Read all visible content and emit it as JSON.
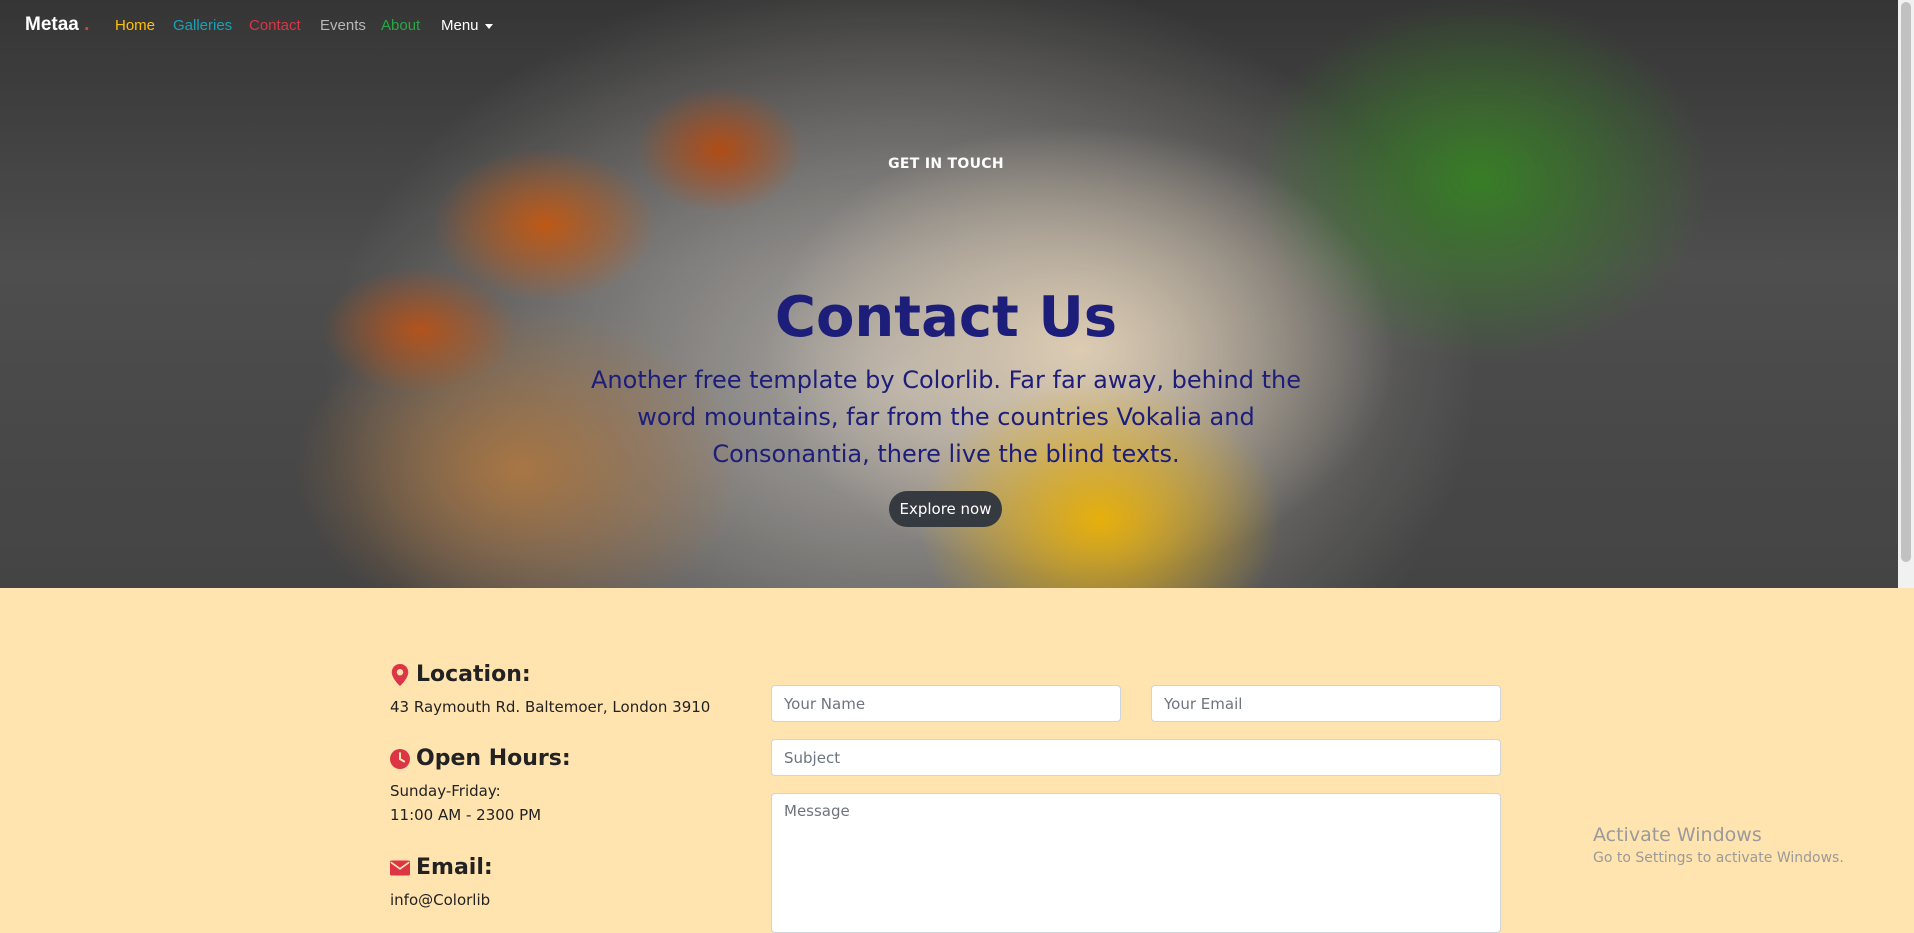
{
  "nav": {
    "brand": "Metaa",
    "brand_dot": ".",
    "items": [
      {
        "label": "Home",
        "color": "#ffc107"
      },
      {
        "label": "Galleries",
        "color": "#17a2b8"
      },
      {
        "label": "Contact",
        "color": "#dc3545"
      },
      {
        "label": "Events",
        "color": "#b8b8b8"
      },
      {
        "label": "About",
        "color": "#28a745"
      },
      {
        "label": "Menu",
        "color": "#ffffff"
      }
    ]
  },
  "hero": {
    "eyebrow": "GET IN TOUCH",
    "title": "Contact Us",
    "subtitle": "Another free template by Colorlib. Far far away, behind the word mountains, far from the countries Vokalia and Consonantia, there live the blind texts.",
    "button": "Explore now"
  },
  "contact": {
    "location": {
      "heading": "Location:",
      "icon": "map-pin-icon",
      "address": "43 Raymouth Rd. Baltemoer, London 3910"
    },
    "hours": {
      "heading": "Open Hours:",
      "icon": "clock-icon",
      "days": "Sunday-Friday:",
      "time": "11:00 AM - 2300 PM"
    },
    "email": {
      "heading": "Email:",
      "icon": "envelope-icon",
      "value": "info@Colorlib"
    },
    "form": {
      "name_placeholder": "Your Name",
      "email_placeholder": "Your Email",
      "subject_placeholder": "Subject",
      "message_placeholder": "Message"
    }
  },
  "overlay": {
    "line1": "Activate Windows",
    "line2": "Go to Settings to activate Windows."
  },
  "colors": {
    "accent": "#dc3545",
    "title": "#1d1d7a",
    "section_bg": "#ffe4b0",
    "button_bg": "#343a40"
  }
}
